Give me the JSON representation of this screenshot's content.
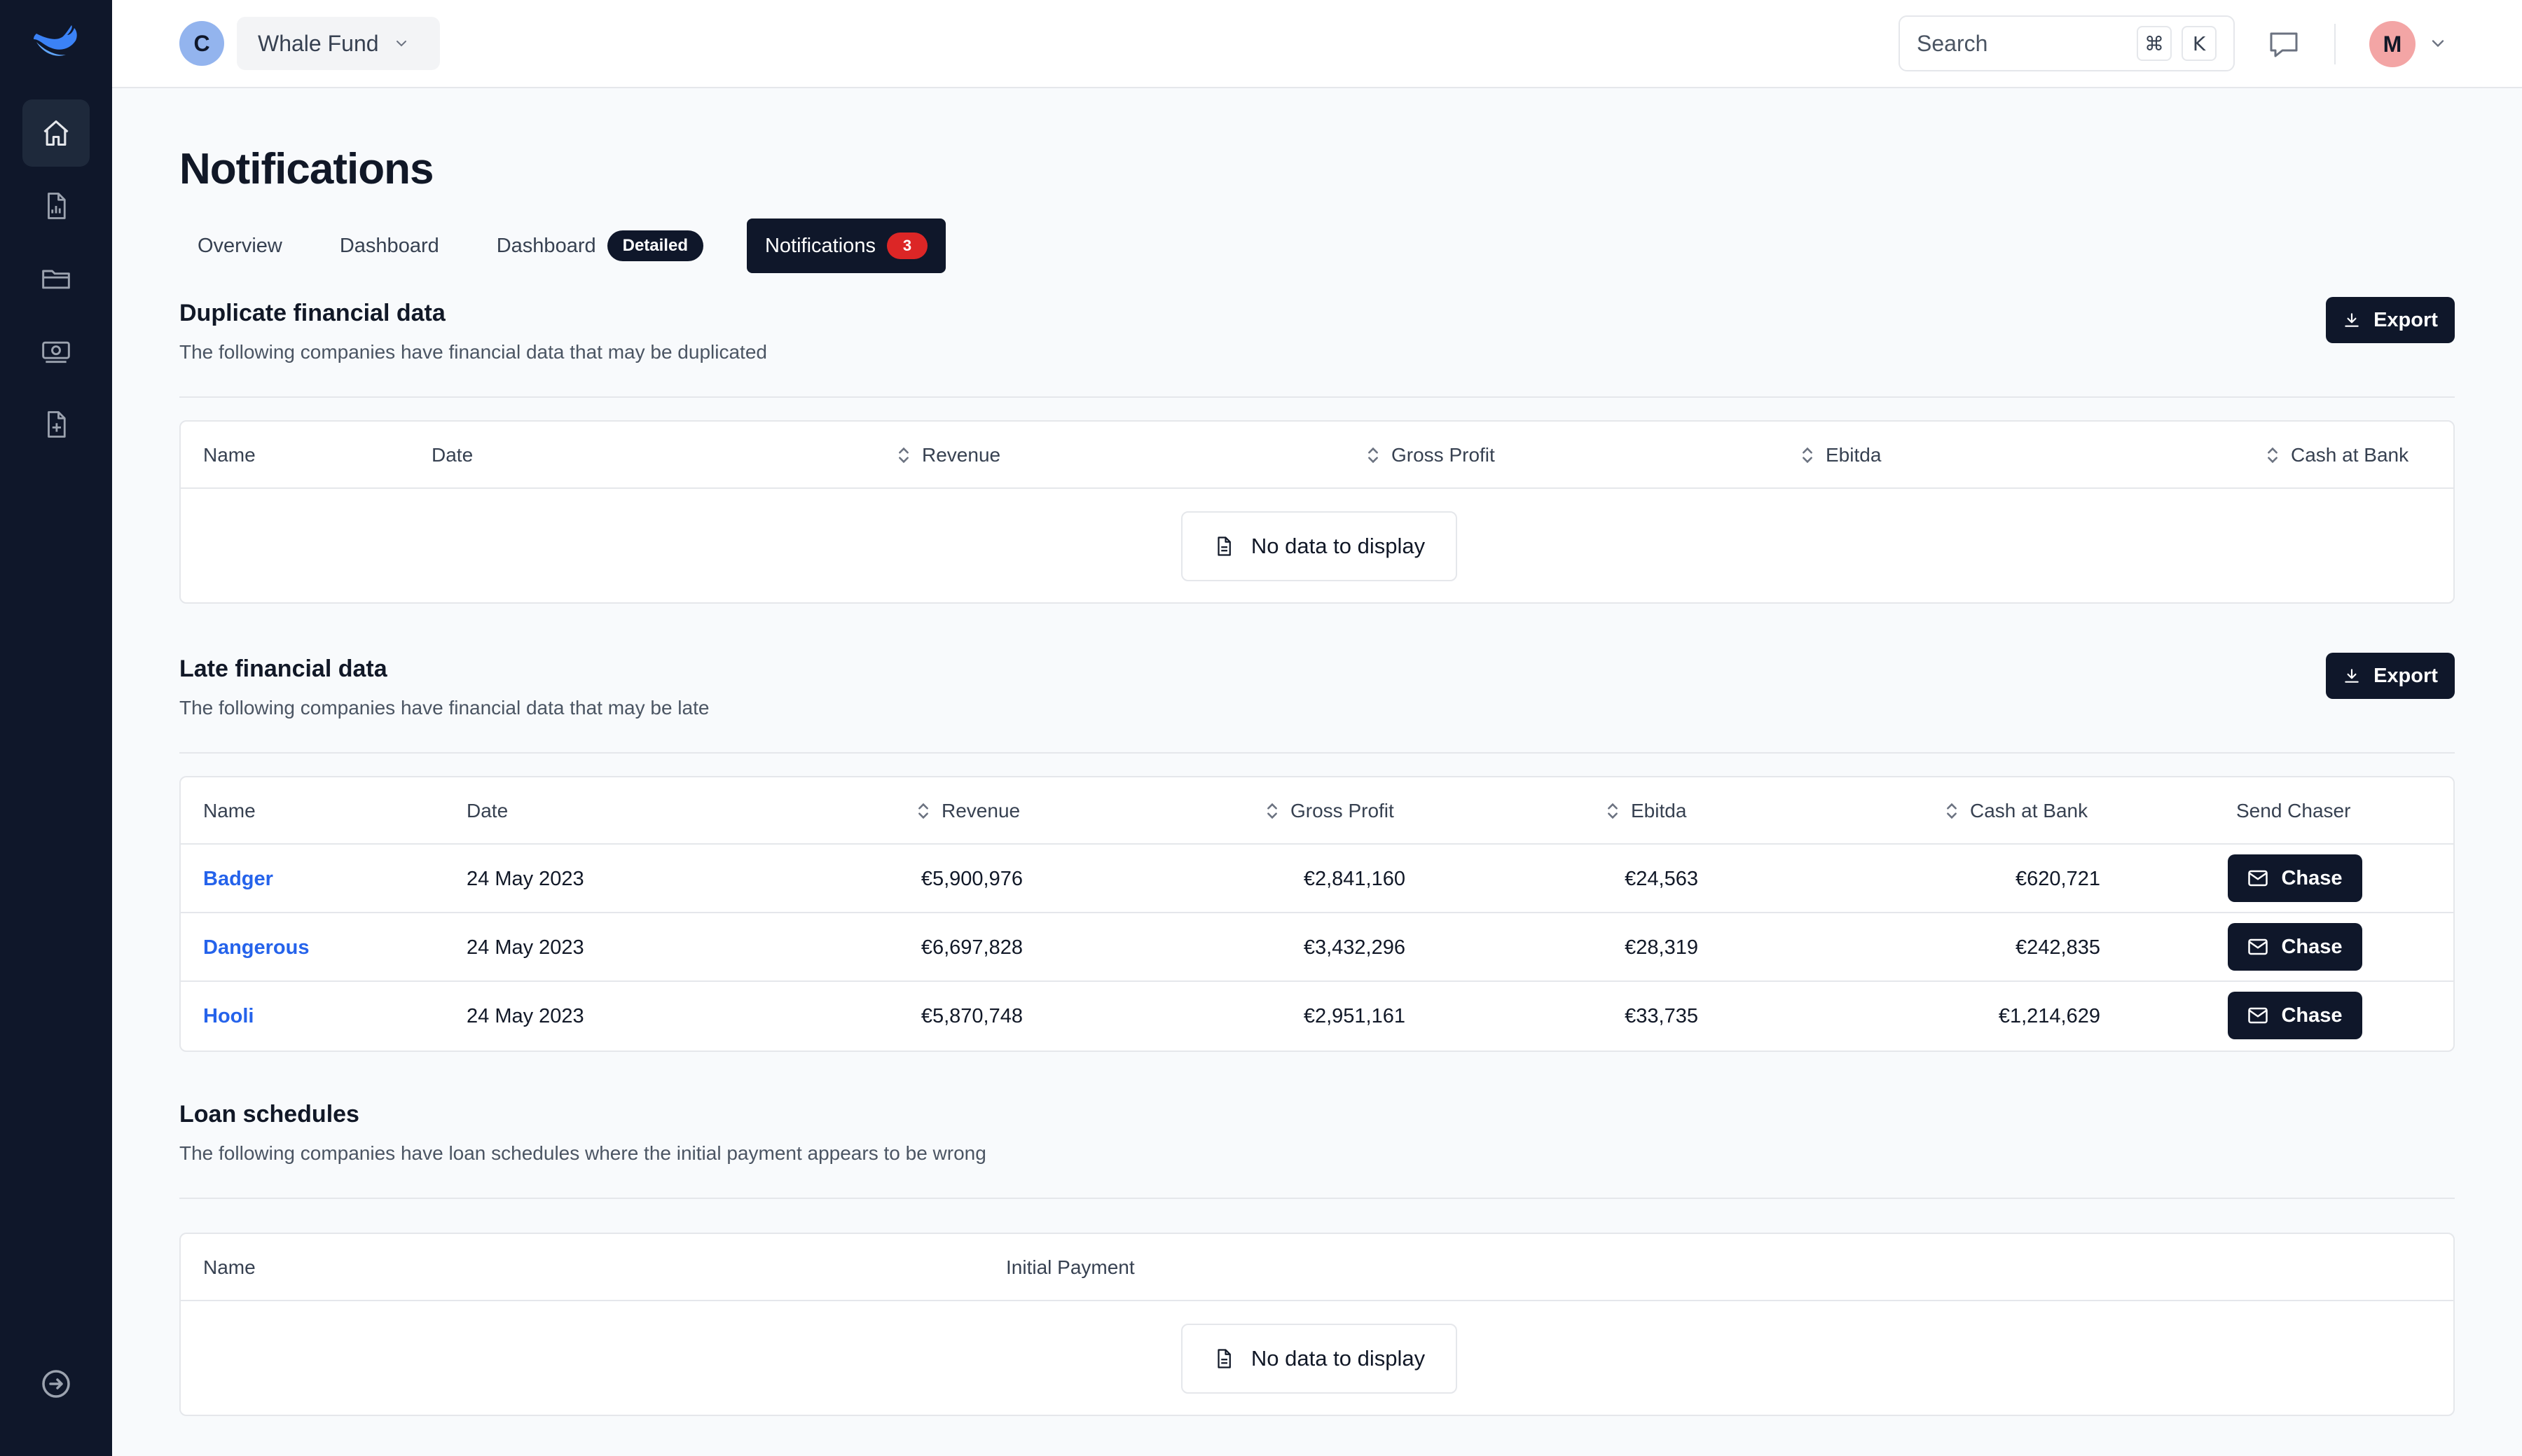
{
  "header": {
    "workspace_initial": "C",
    "workspace_name": "Whale Fund",
    "search_placeholder": "Search",
    "search_shortcut": [
      "⌘",
      "K"
    ],
    "user_initial": "M"
  },
  "sidebar": {
    "items": [
      {
        "icon": "home-icon",
        "active": true
      },
      {
        "icon": "report-icon",
        "active": false
      },
      {
        "icon": "folder-icon",
        "active": false
      },
      {
        "icon": "cash-icon",
        "active": false
      },
      {
        "icon": "file-add-icon",
        "active": false
      }
    ],
    "bottom_icon": "logout-icon"
  },
  "page": {
    "title": "Notifications",
    "tabs": [
      {
        "label": "Overview"
      },
      {
        "label": "Dashboard"
      },
      {
        "label": "Dashboard",
        "badge": "Detailed"
      },
      {
        "label": "Notifications",
        "count": "3",
        "active": true
      }
    ]
  },
  "duplicate": {
    "title": "Duplicate financial data",
    "description": "The following companies have financial data that may be duplicated",
    "export_label": "Export",
    "columns": [
      "Name",
      "Date",
      "Revenue",
      "Gross Profit",
      "Ebitda",
      "Cash at Bank"
    ],
    "empty_label": "No data to display"
  },
  "late": {
    "title": "Late financial data",
    "description": "The following companies have financial data that may be late",
    "export_label": "Export",
    "columns": [
      "Name",
      "Date",
      "Revenue",
      "Gross Profit",
      "Ebitda",
      "Cash at Bank",
      "Send Chaser"
    ],
    "rows": [
      {
        "name": "Badger",
        "date": "24 May 2023",
        "revenue": "€5,900,976",
        "gross_profit": "€2,841,160",
        "ebitda": "€24,563",
        "cash": "€620,721",
        "action": "Chase"
      },
      {
        "name": "Dangerous",
        "date": "24 May 2023",
        "revenue": "€6,697,828",
        "gross_profit": "€3,432,296",
        "ebitda": "€28,319",
        "cash": "€242,835",
        "action": "Chase"
      },
      {
        "name": "Hooli",
        "date": "24 May 2023",
        "revenue": "€5,870,748",
        "gross_profit": "€2,951,161",
        "ebitda": "€33,735",
        "cash": "€1,214,629",
        "action": "Chase"
      }
    ]
  },
  "loans": {
    "title": "Loan schedules",
    "description": "The following companies have loan schedules where the initial payment appears to be wrong",
    "columns": [
      "Name",
      "Initial Payment"
    ],
    "empty_label": "No data to display"
  },
  "colors": {
    "sidebar": "#0f172a",
    "accent": "#0f172a",
    "link": "#2563eb",
    "badge_red": "#dc2626"
  }
}
